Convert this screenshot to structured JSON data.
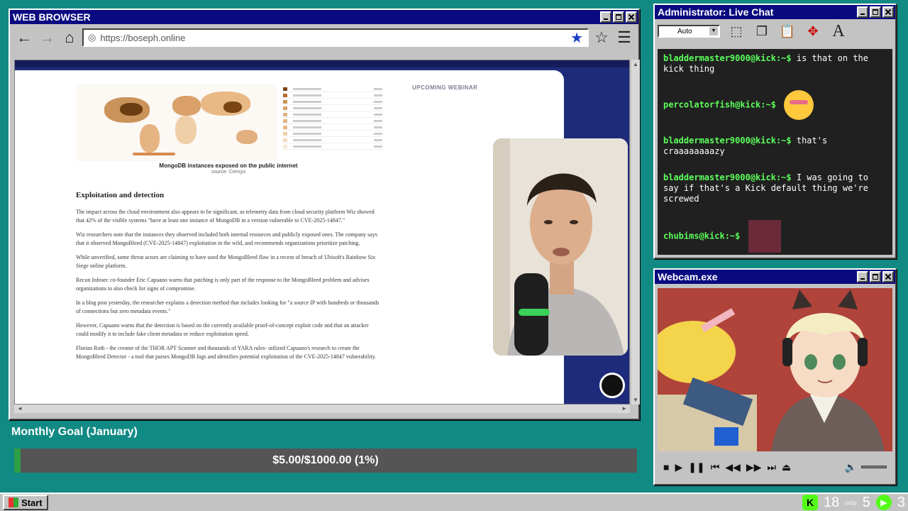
{
  "browser": {
    "title": "WEB BROWSER",
    "url": "https://boseph.online"
  },
  "article": {
    "map_caption": "MongoDB instances exposed on the public internet",
    "map_source": "source: Censys",
    "webinar": "UPCOMING WEBINAR",
    "heading": "Exploitation and detection",
    "paragraphs": [
      "The impact across the cloud environment also appears to be significant, as telemetry data from cloud security platform Wiz showed that 42% of the visible systems \"have at least one instance of MongoDB in a version vulnerable to CVE-2025-14847.\"",
      "Wiz researchers note that the instances they observed included both internal resources and publicly exposed ones. The company says that it observed MongoBleed (CVE-2025-14847) exploitation in the wild, and recommends organizations prioritize patching.",
      "While unverified, some threat actors are claiming to have used the MongoBleed flaw in a recent of breach of Ubisoft's Rainbow Six Siege online platform.",
      "Recon Infosec co-founder Eric Capuano warns that patching is only part of the response to the MongoBleed problem and advises organizations to also check for signs of compromise.",
      "In a blog post yesterday, the researcher explains a detection method that includes looking for \"a source IP with hundreds or thousands of connections but zero metadata events.\"",
      "However, Capuano warns that the detection is based on the currently available proof-of-concept exploit code and that an attacker could modify it to include fake client metadata or reduce exploitation speed.",
      "Florian Roth - the creator of the THOR APT Scanner and thousands of YARA rules- utilized Capuano's research to create the MongoBleed Detector - a tool that parses MongoDB logs and identifies potential exploitation of the CVE-2025-14847 vulnerability."
    ]
  },
  "goal": {
    "label": "Monthly Goal (January)",
    "text": "$5.00/$1000.00 (1%)",
    "progress_pct": 1
  },
  "chat": {
    "title": "Administrator: Live Chat",
    "font_size_select": "Auto",
    "messages": [
      {
        "user": "bladdermaster9000@kick:~$",
        "text": "is that on the kick thing"
      },
      {
        "user": "percolatorfish@kick:~$",
        "emote": "blushing-emote"
      },
      {
        "user": "bladdermaster9000@kick:~$",
        "text": "that's craaaaaaaazy"
      },
      {
        "user": "bladdermaster9000@kick:~$",
        "text": "I was going to say if that's a Kick default thing we're screwed"
      },
      {
        "user": "chubims@kick:~$",
        "emote": "image-emote"
      }
    ]
  },
  "webcam": {
    "title": "Webcam.exe"
  },
  "taskbar": {
    "start": "Start",
    "followers": "18",
    "cozy": "cozy",
    "subs": "5",
    "viewers": "3"
  },
  "colors": {
    "desktop": "#128a84",
    "titlebar": "#0a0a80",
    "chat_user": "#5cff5c",
    "kick_green": "#53fc18"
  }
}
